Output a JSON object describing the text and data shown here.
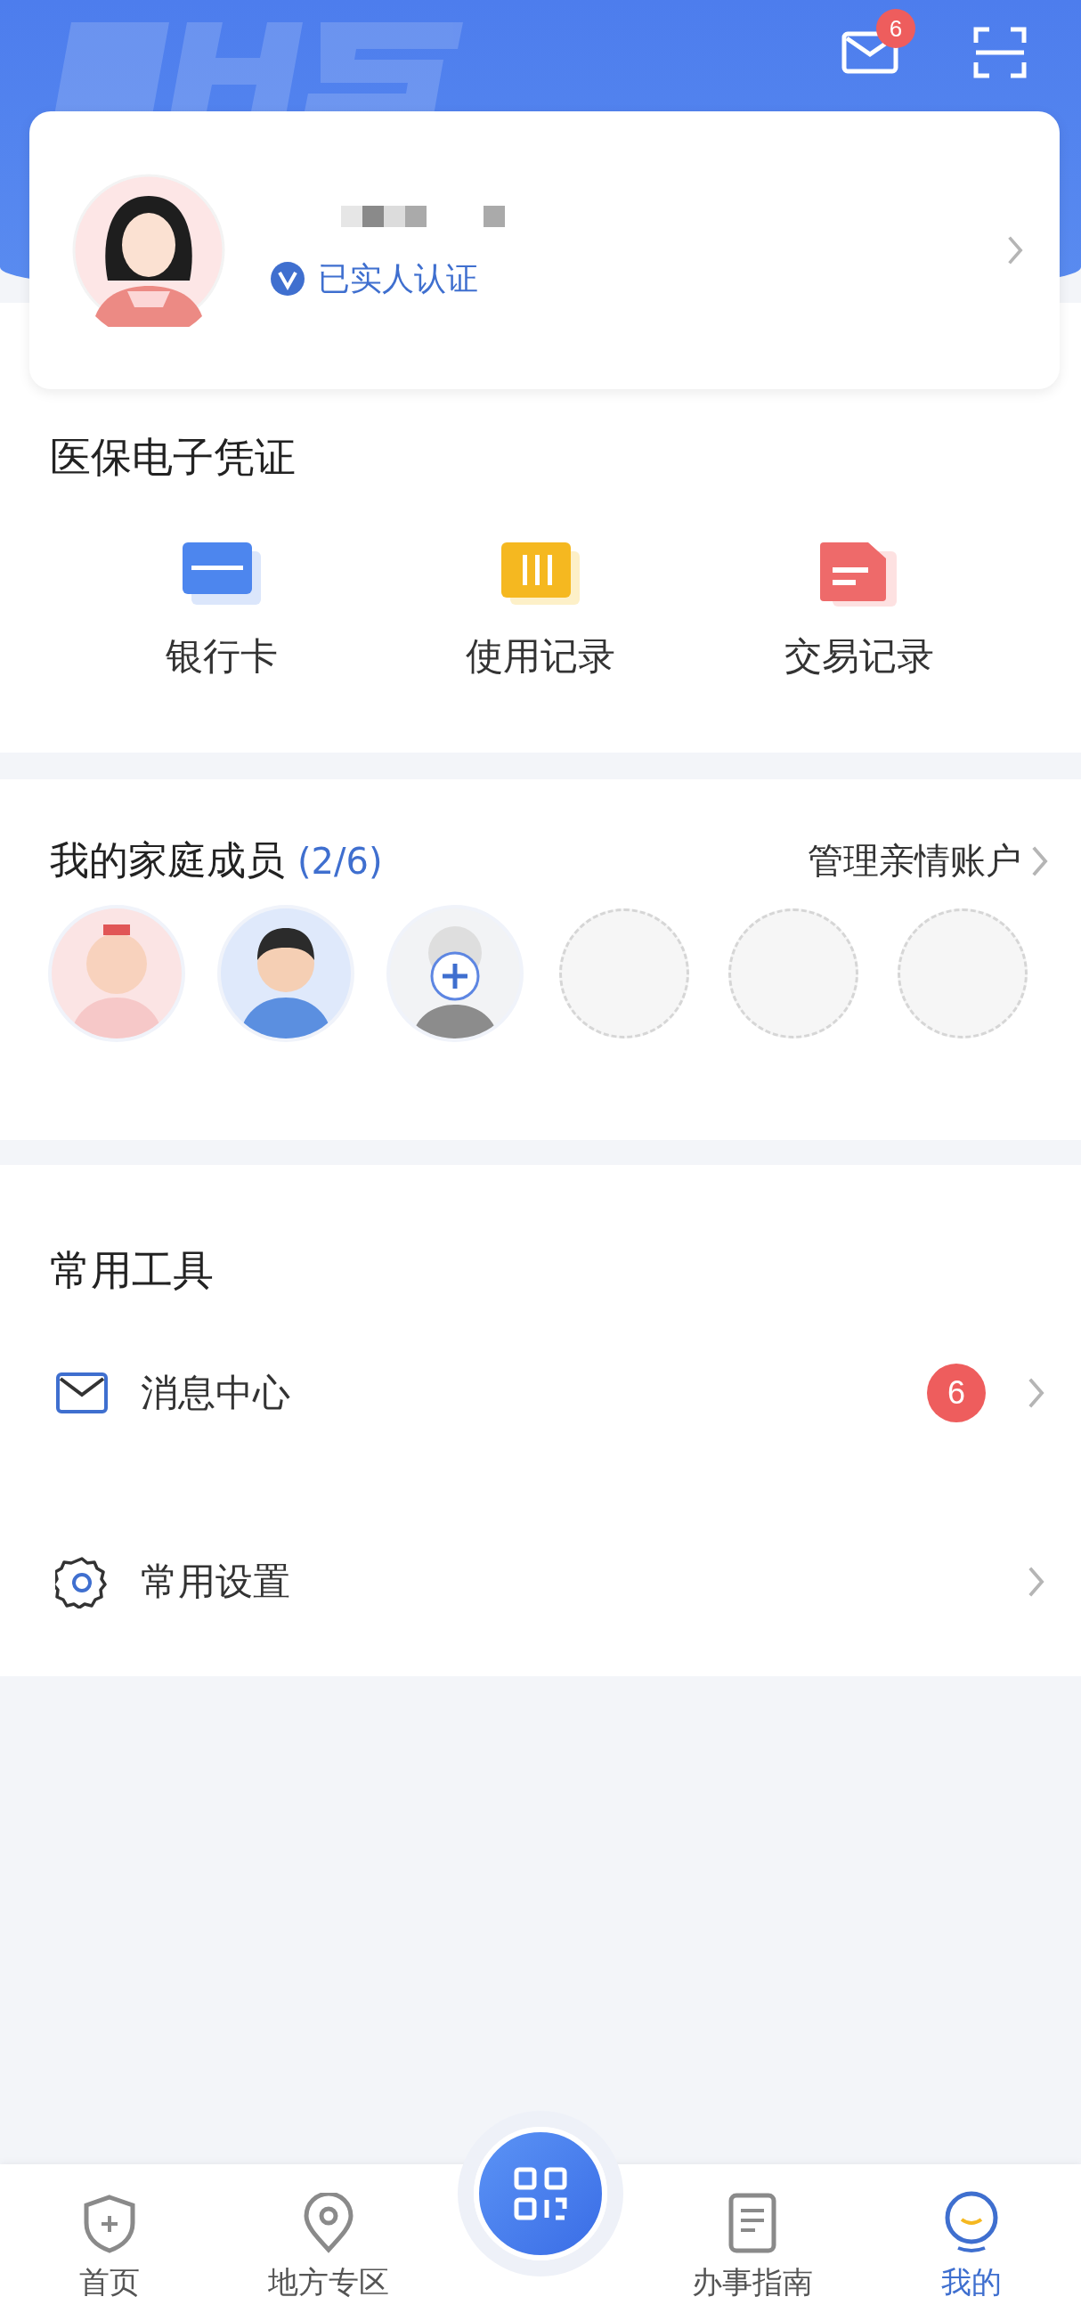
{
  "header": {
    "mail_badge": "6"
  },
  "profile": {
    "verified_label": "已实人认证"
  },
  "credential": {
    "title": "医保电子凭证",
    "items": [
      {
        "kind": "card",
        "label": "银行卡"
      },
      {
        "kind": "usage",
        "label": "使用记录"
      },
      {
        "kind": "trade",
        "label": "交易记录"
      }
    ]
  },
  "family": {
    "title": "我的家庭成员",
    "count": "(2/6)",
    "manage_link": "管理亲情账户",
    "slots": [
      {
        "kind": "child"
      },
      {
        "kind": "adult"
      },
      {
        "kind": "add"
      },
      {
        "kind": "empty"
      },
      {
        "kind": "empty"
      },
      {
        "kind": "empty"
      }
    ]
  },
  "tools": {
    "title": "常用工具",
    "items": [
      {
        "kind": "message",
        "label": "消息中心",
        "badge": "6"
      },
      {
        "kind": "settings",
        "label": "常用设置"
      }
    ]
  },
  "tabbar": {
    "tabs": [
      {
        "kind": "home",
        "label": "首页",
        "selected": false
      },
      {
        "kind": "location",
        "label": "地方专区",
        "selected": false
      },
      {
        "kind": "guide",
        "label": "办事指南",
        "selected": false
      },
      {
        "kind": "mine",
        "label": "我的",
        "selected": true
      }
    ]
  }
}
